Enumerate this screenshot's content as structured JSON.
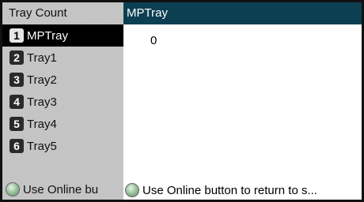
{
  "left_panel": {
    "header": "Tray Count",
    "items": [
      {
        "num": "1",
        "label": "MPTray"
      },
      {
        "num": "2",
        "label": "Tray1"
      },
      {
        "num": "3",
        "label": "Tray2"
      },
      {
        "num": "4",
        "label": "Tray3"
      },
      {
        "num": "5",
        "label": "Tray4"
      },
      {
        "num": "6",
        "label": "Tray5"
      }
    ],
    "footer_text": "Use Online bu"
  },
  "right_panel": {
    "header": "MPTray",
    "value": "0",
    "footer_text": "Use Online button to return to s..."
  },
  "colors": {
    "header_bg": "#0d3f52",
    "selected_bg": "#000000",
    "led": "#9cc59c"
  },
  "icons": {
    "online_indicator": "online-led-icon"
  }
}
